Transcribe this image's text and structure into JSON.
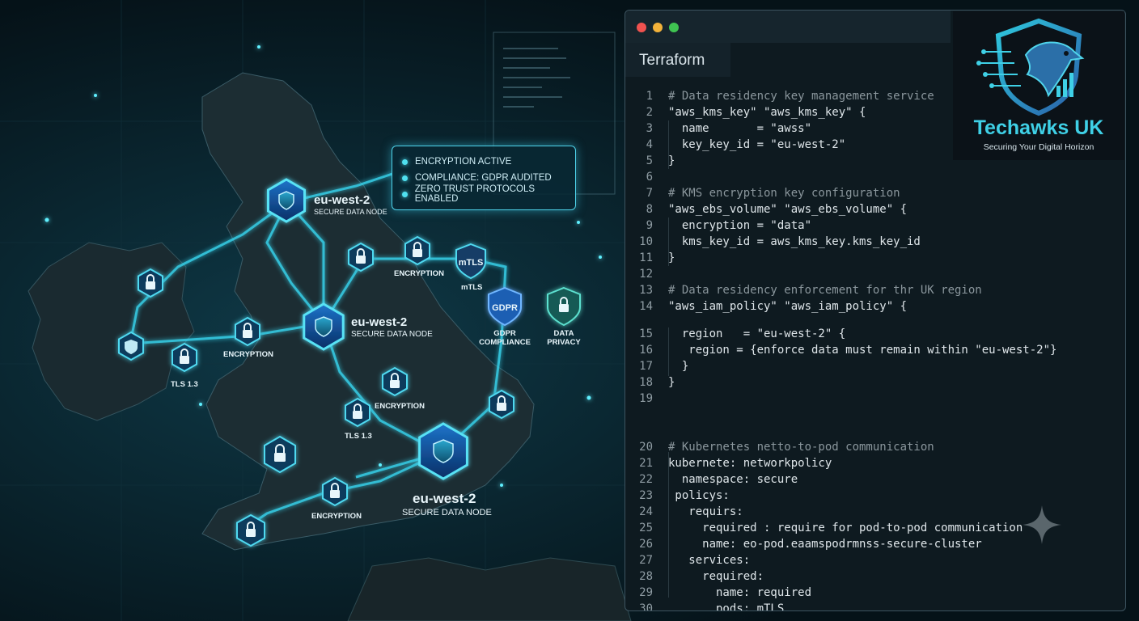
{
  "map": {
    "nodes": [
      {
        "region": "eu-west-2",
        "subtitle": "SECURE DATA NODE"
      },
      {
        "region": "eu-west-2",
        "subtitle": "SECURE DATA NODE"
      },
      {
        "region": "eu-west-2",
        "subtitle": "SECURE DATA NODE"
      }
    ],
    "badges": {
      "encryption": "ENCRYPTION",
      "tls": "TLS 1.3",
      "mtls": "mTLS",
      "gdpr_icon": "GDPR",
      "gdpr_line1": "GDPR",
      "gdpr_line2": "COMPLIANCE",
      "privacy_line1": "DATA",
      "privacy_line2": "PRIVACY"
    },
    "status_panel": [
      "ENCRYPTION ACTIVE",
      "COMPLIANCE: GDPR AUDITED",
      "ZERO TRUST PROTOCOLS ENABLED"
    ]
  },
  "editor": {
    "tab_label": "Terraform",
    "lines": [
      {
        "n": "1",
        "text": "# Data residency key management service"
      },
      {
        "n": "2",
        "text": "\"aws_kms_key\" \"aws_kms_key\" {"
      },
      {
        "n": "3",
        "text": "  name       = \"awss\""
      },
      {
        "n": "4",
        "text": "  key_key_id = \"eu-west-2\""
      },
      {
        "n": "5",
        "text": "}"
      },
      {
        "n": "6",
        "text": ""
      },
      {
        "n": "7",
        "text": "# KMS encryption key configuration"
      },
      {
        "n": "8",
        "text": "\"aws_ebs_volume\" \"aws_ebs_volume\" {"
      },
      {
        "n": "9",
        "text": "  encryption = \"data\""
      },
      {
        "n": "10",
        "text": "  kms_key_id = aws_kms_key.kms_key_id"
      },
      {
        "n": "11",
        "text": "}"
      },
      {
        "n": "12",
        "text": ""
      },
      {
        "n": "13",
        "text": "# Data residency enforcement for thr UK region"
      },
      {
        "n": "14",
        "text": "\"aws_iam_policy\" \"aws_iam_policy\" {"
      },
      {
        "n": "15",
        "text": "  region   = \"eu-west-2\" {"
      },
      {
        "n": "16",
        "text": "   region = {enforce data must remain within \"eu-west-2\"}"
      },
      {
        "n": "17",
        "text": "  }"
      },
      {
        "n": "18",
        "text": "}"
      },
      {
        "n": "19",
        "text": ""
      },
      {
        "n": "20",
        "text": "# Kubernetes netto-to-pod communication"
      },
      {
        "n": "21",
        "text": "kubernete: networkpolicy"
      },
      {
        "n": "22",
        "text": "  namespace: secure"
      },
      {
        "n": "23",
        "text": " policys:"
      },
      {
        "n": "24",
        "text": "   requirs:"
      },
      {
        "n": "25",
        "text": "     required : require for pod-to-pod communication"
      },
      {
        "n": "26",
        "text": "     name: eo-pod.eaamspodrmnss-secure-cluster"
      },
      {
        "n": "27",
        "text": "   services:"
      },
      {
        "n": "28",
        "text": "     required:"
      },
      {
        "n": "29",
        "text": "       name: required"
      },
      {
        "n": "30",
        "text": "       pods: mTLS"
      }
    ]
  },
  "brand": {
    "name": "Techawks UK",
    "tagline": "Securing Your Digital Horizon"
  },
  "colors": {
    "accent": "#3fd0e6",
    "glow": "#4fe0f0",
    "code_comment": "#8a969c",
    "code_string": "#d6e89a",
    "code_key": "#74c8de"
  }
}
